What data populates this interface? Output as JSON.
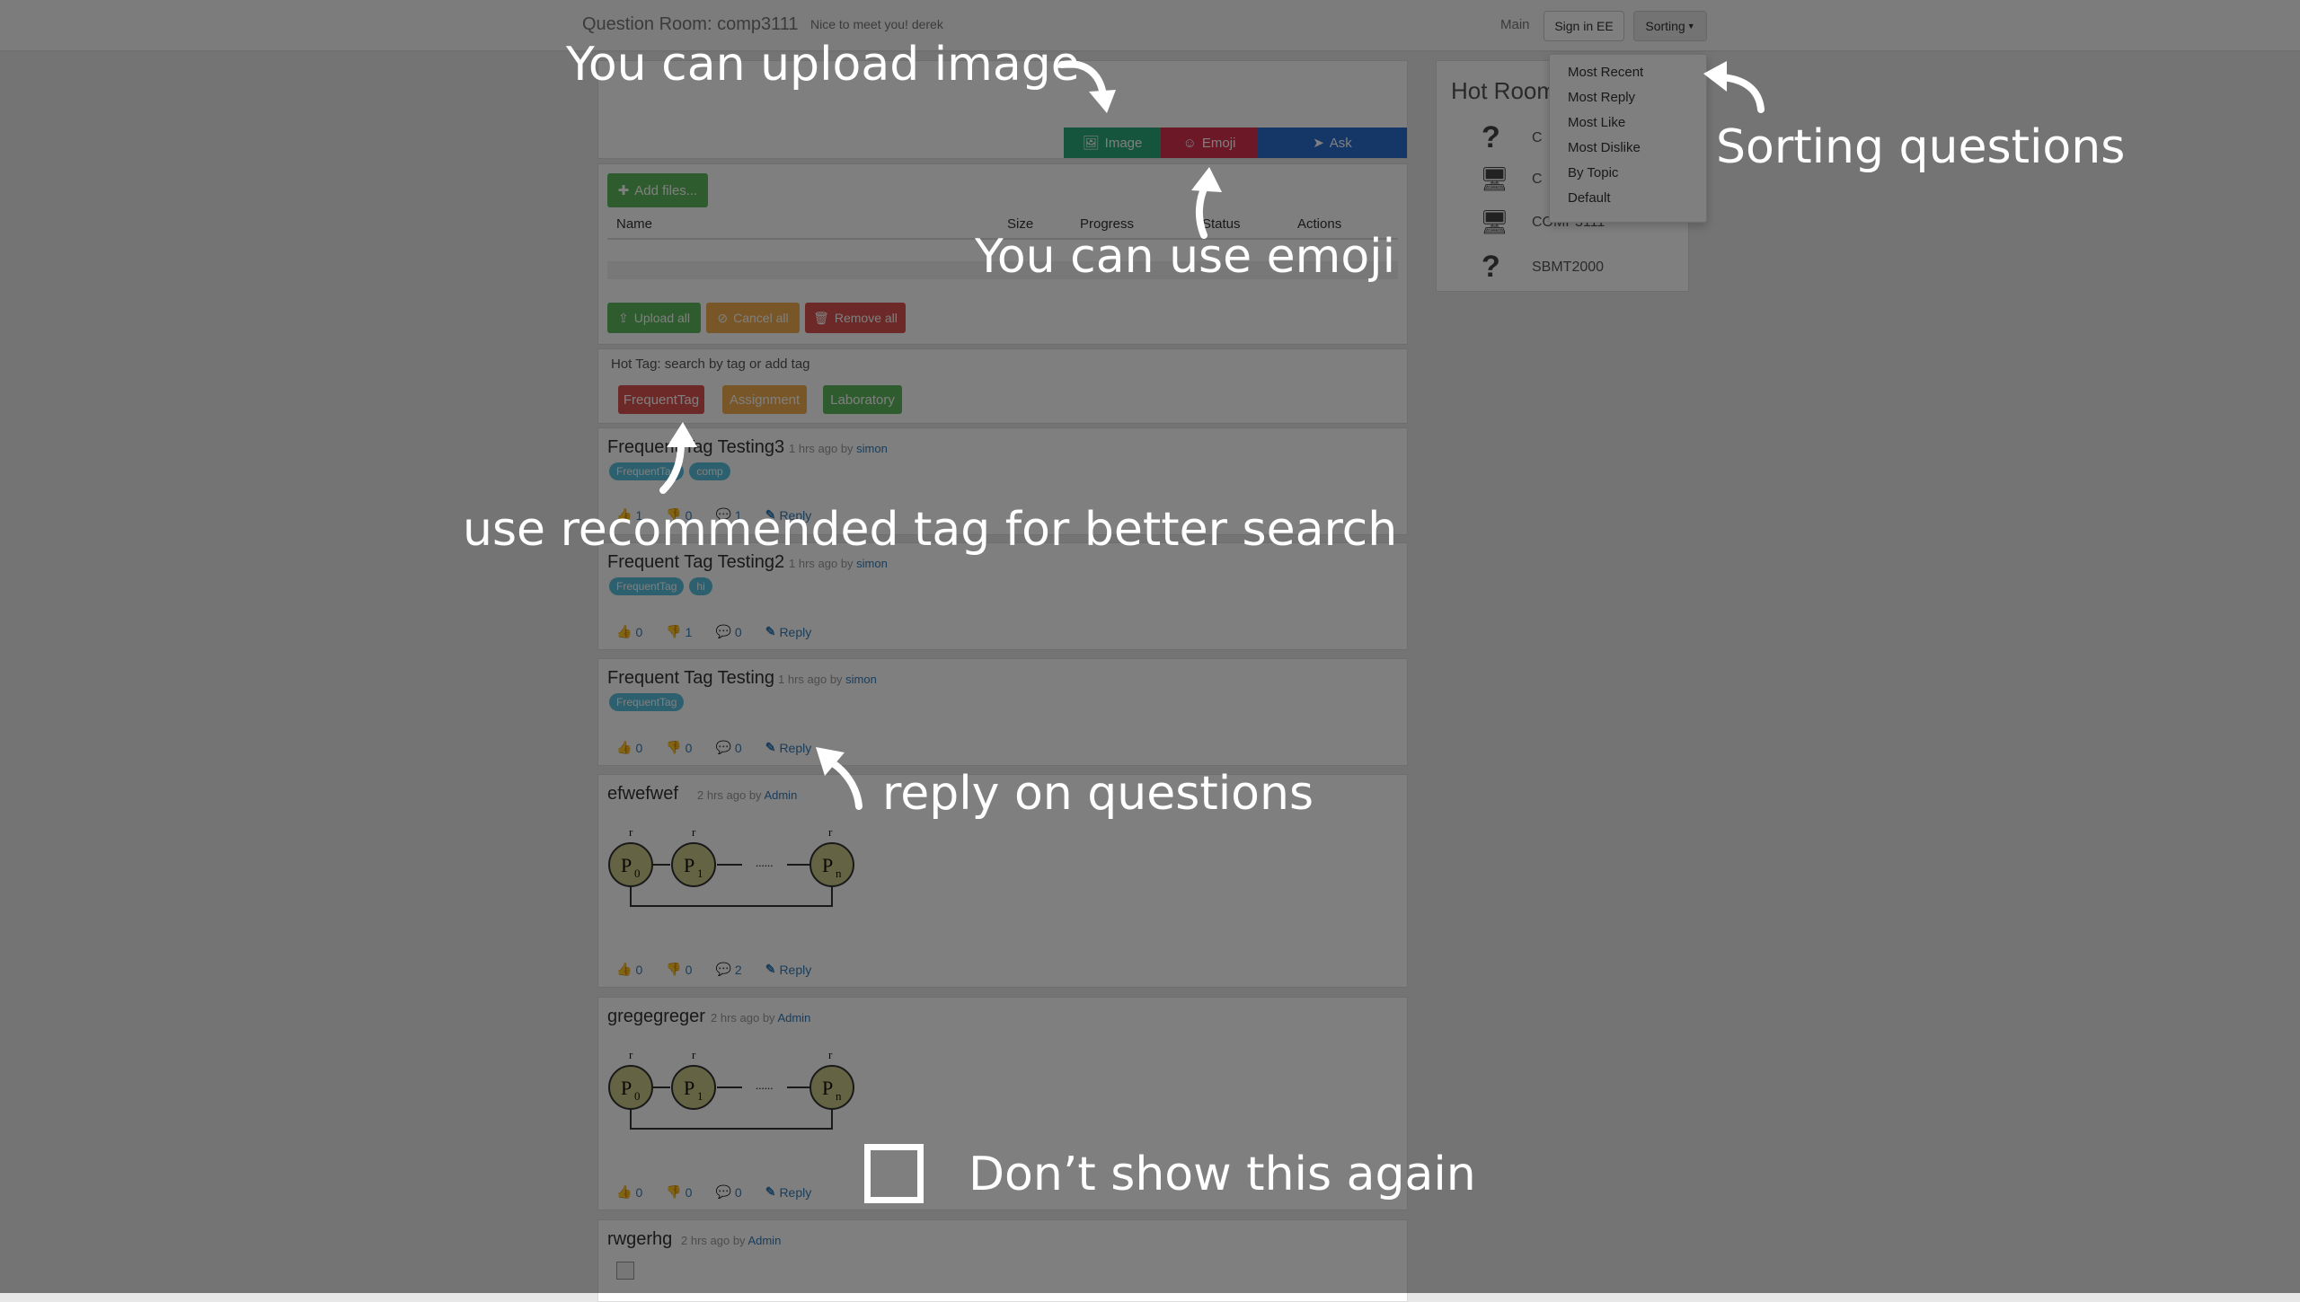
{
  "navbar": {
    "title": "Question Room: comp3111",
    "greeting": "Nice to meet you! derek",
    "main_link": "Main",
    "signin_label": "Sign in EE",
    "sorting_label": "Sorting"
  },
  "composer": {
    "image_label": "Image",
    "emoji_label": "Emoji",
    "ask_label": "Ask"
  },
  "upload": {
    "add_files_label": "Add files...",
    "columns": [
      "Name",
      "Size",
      "Progress",
      "Status",
      "Actions"
    ],
    "upload_all_label": "Upload all",
    "cancel_all_label": "Cancel all",
    "remove_all_label": "Remove all"
  },
  "hot_tag": {
    "heading": "Hot Tag: search by tag or add tag",
    "tags": [
      {
        "label": "FrequentTag",
        "color": "#d9534f"
      },
      {
        "label": "Assignment",
        "color": "#f0ad4e"
      },
      {
        "label": "Laboratory",
        "color": "#5cb85c"
      }
    ]
  },
  "questions": [
    {
      "title": "Frequent Tag Testing3",
      "time": "1 hrs ago by",
      "author": "simon",
      "tags": [
        "FrequentTag",
        "comp"
      ],
      "likes": "1",
      "dislikes": "0",
      "comments": "1",
      "reply_label": "Reply"
    },
    {
      "title": "Frequent Tag Testing2",
      "time": "1 hrs ago by",
      "author": "simon",
      "tags": [
        "FrequentTag",
        "hi"
      ],
      "likes": "0",
      "dislikes": "1",
      "comments": "0",
      "reply_label": "Reply"
    },
    {
      "title": "Frequent Tag Testing",
      "time": "1 hrs ago by",
      "author": "simon",
      "tags": [
        "FrequentTag"
      ],
      "likes": "0",
      "dislikes": "0",
      "comments": "0",
      "reply_label": "Reply"
    },
    {
      "title": "efwefwef",
      "time": "2 hrs ago by",
      "author": "Admin",
      "tags": [],
      "likes": "0",
      "dislikes": "0",
      "comments": "2",
      "reply_label": "Reply"
    },
    {
      "title": "gregegreger",
      "time": "2 hrs ago by",
      "author": "Admin",
      "tags": [],
      "likes": "0",
      "dislikes": "0",
      "comments": "0",
      "reply_label": "Reply"
    },
    {
      "title": "rwgerhg",
      "time": "2 hrs ago by",
      "author": "Admin"
    }
  ],
  "diagram": {
    "nodes": [
      "P",
      "P",
      "P"
    ],
    "subs": [
      "0",
      "1",
      "n"
    ],
    "tops": [
      "r",
      "r",
      "r"
    ],
    "top_subs": [
      "0",
      "1",
      "n"
    ],
    "dots": "......"
  },
  "hot_room": {
    "heading": "Hot Room",
    "rooms": [
      {
        "name": "C",
        "icon": "question-icon"
      },
      {
        "name": "C",
        "icon": "desktop-icon"
      },
      {
        "name": "COMP3111",
        "icon": "desktop-icon"
      },
      {
        "name": "SBMT2000",
        "icon": "question-icon"
      }
    ]
  },
  "sorting_menu": [
    "Most Recent",
    "Most Reply",
    "Most Like",
    "Most Dislike",
    "By Topic",
    "Default"
  ],
  "annotations": {
    "upload_image": "You can upload image",
    "use_emoji": "You can use emoji",
    "sorting": "Sorting questions",
    "recommended_tag": "use recommended tag for better search",
    "reply": "reply on questions",
    "dont_show": "Don’t show this again"
  },
  "colors": {
    "image_btn": "#2aa87a",
    "emoji_btn": "#d9304f",
    "ask_btn": "#2a6ed0",
    "add_files": "#5cb85c",
    "upload_all": "#5cb85c",
    "cancel_all": "#f0ad4e",
    "remove_all": "#d9534f",
    "tag_pill": "#5bc0de"
  }
}
